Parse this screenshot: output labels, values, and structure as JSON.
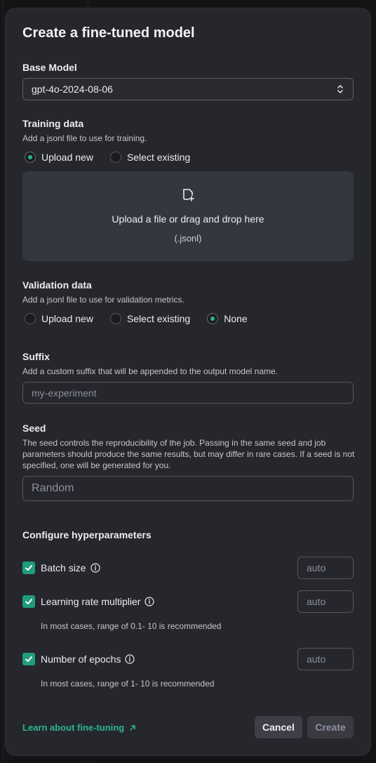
{
  "modal": {
    "title": "Create a fine-tuned model"
  },
  "base_model": {
    "label": "Base Model",
    "value": "gpt-4o-2024-08-06"
  },
  "training": {
    "label": "Training data",
    "description": "Add a jsonl file to use for training.",
    "options": [
      "Upload new",
      "Select existing"
    ],
    "selected": "Upload new",
    "dropzone_text": "Upload a file or drag and drop here",
    "dropzone_hint": "(.jsonl)"
  },
  "validation": {
    "label": "Validation data",
    "description": "Add a jsonl file to use for validation metrics.",
    "options": [
      "Upload new",
      "Select existing",
      "None"
    ],
    "selected": "None"
  },
  "suffix": {
    "label": "Suffix",
    "description": "Add a custom suffix that will be appended to the output model name.",
    "placeholder": "my-experiment"
  },
  "seed": {
    "label": "Seed",
    "description": "The seed controls the reproducibility of the job. Passing in the same seed and job parameters should produce the same results, but may differ in rare cases. If a seed is not specified, one will be generated for you.",
    "placeholder": "Random"
  },
  "hyperparameters": {
    "label": "Configure hyperparameters",
    "batch_size": {
      "label": "Batch size",
      "placeholder": "auto",
      "checked": true
    },
    "lr_multiplier": {
      "label": "Learning rate multiplier",
      "placeholder": "auto",
      "checked": true,
      "hint": "In most cases, range of 0.1- 10 is recommended"
    },
    "epochs": {
      "label": "Number of epochs",
      "placeholder": "auto",
      "checked": true,
      "hint": "In most cases, range of 1- 10 is recommended"
    }
  },
  "footer": {
    "learn_link": "Learn about fine-tuning",
    "cancel": "Cancel",
    "create": "Create"
  },
  "colors": {
    "accent": "#2bb592",
    "checkbox": "#1f9d7e",
    "modal_bg": "#26272c",
    "dropzone_bg": "#353740"
  },
  "icons": {
    "select": "chevron-updown-icon",
    "upload": "file-add-icon",
    "info": "info-icon",
    "external": "arrow-up-right-icon",
    "check": "check-icon"
  }
}
